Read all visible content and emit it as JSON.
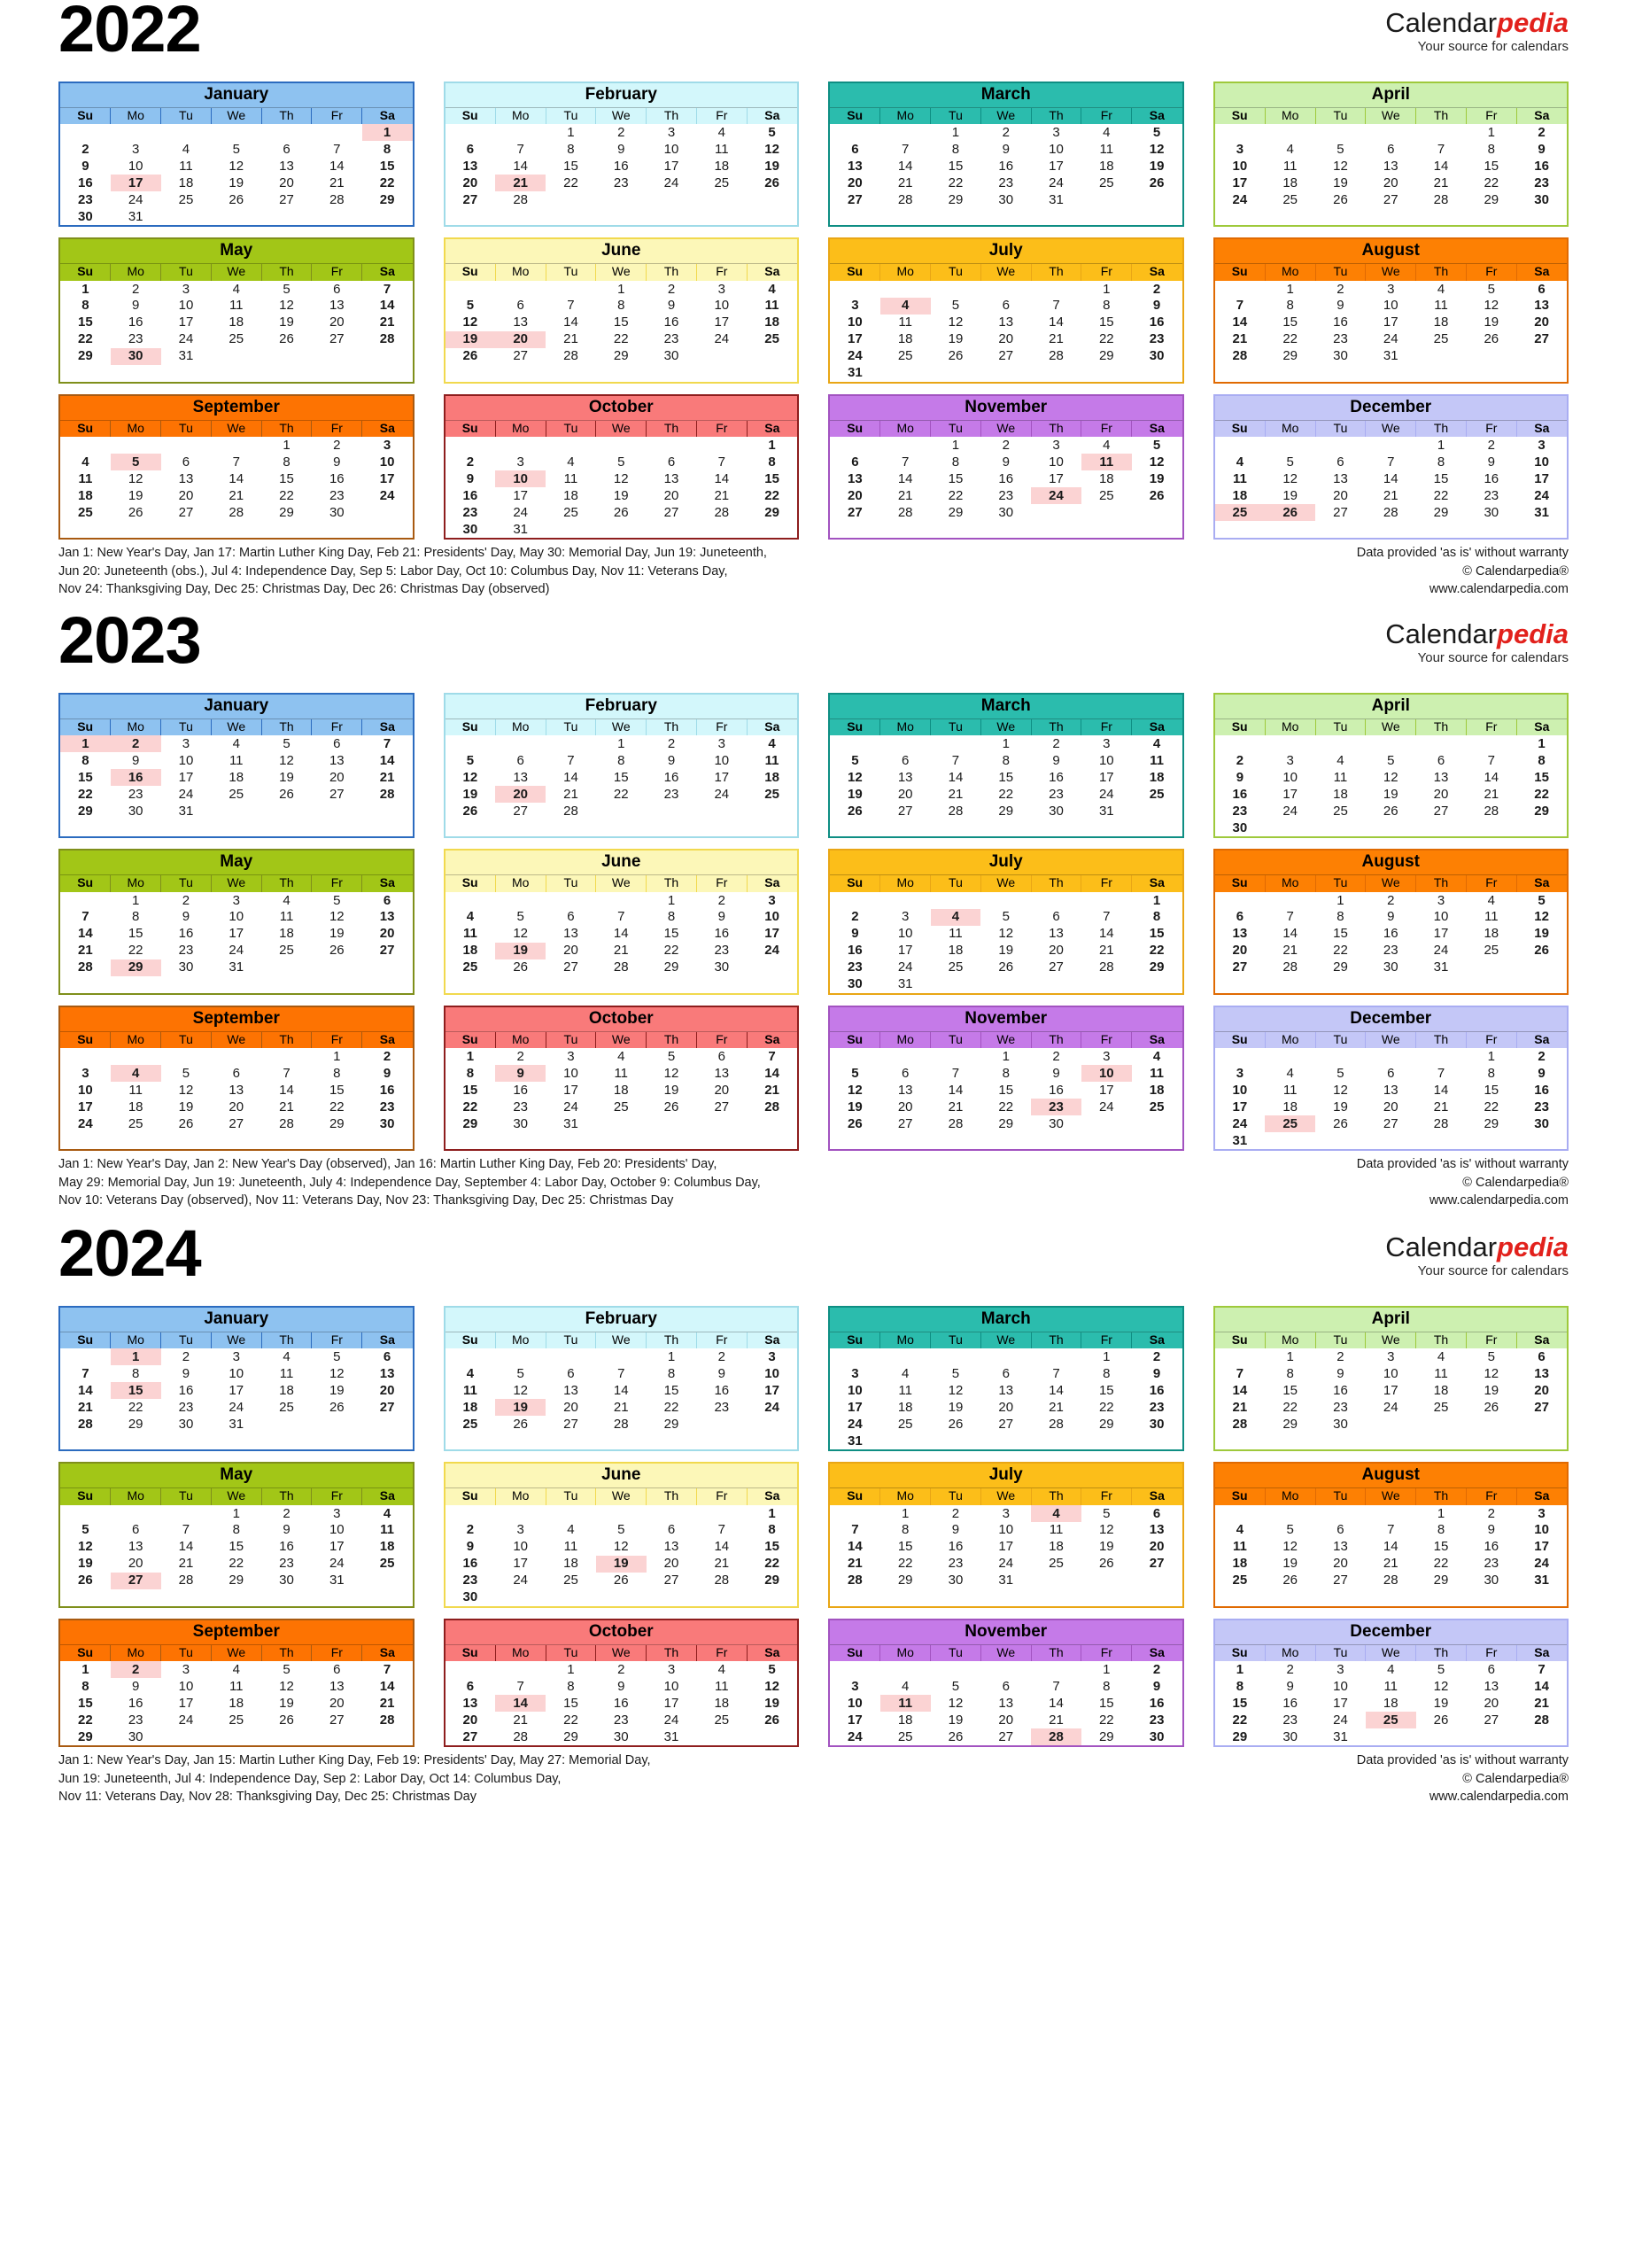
{
  "brand": {
    "name_part1": "Calendar",
    "name_part2": "pedia",
    "tagline": "Your source for calendars"
  },
  "disclaimer": {
    "line1": "Data provided 'as is' without warranty",
    "line2": "© Calendarpedia®",
    "line3": "www.calendarpedia.com"
  },
  "weekdays": [
    "Su",
    "Mo",
    "Tu",
    "We",
    "Th",
    "Fr",
    "Sa"
  ],
  "colors": {
    "january": "#8ec2f0",
    "february": "#d3f7fb",
    "march": "#2bbcad",
    "april": "#cdf0b0",
    "may": "#a2c617",
    "june": "#fcf7b8",
    "july": "#fcbe19",
    "august": "#fd8003",
    "september": "#fd7302",
    "october": "#f97a7a",
    "november": "#c57ae8",
    "december": "#c4c7f7",
    "january_border": "#2b6bbf",
    "february_border": "#9fdbe8",
    "march_border": "#0e8e83",
    "april_border": "#9ec93b",
    "may_border": "#7f8f1b",
    "june_border": "#f1d94e",
    "july_border": "#e9a615",
    "august_border": "#e06a02",
    "september_border": "#a85a11",
    "october_border": "#8e1e1e",
    "november_border": "#a253c0",
    "december_border": "#a9adf2",
    "sunday_text": "#e00000",
    "saturday_text": "#0000d8",
    "holiday_bg": "#fbd3d3",
    "brand_red": "#e2211c"
  },
  "years": [
    {
      "year": "2022",
      "holidays_text": [
        "Jan 1: New Year's Day, Jan 17: Martin Luther King Day, Feb 21: Presidents' Day, May 30: Memorial Day, Jun 19: Juneteenth,",
        "Jun 20: Juneteenth (obs.), Jul 4: Independence Day, Sep 5: Labor Day, Oct 10: Columbus Day, Nov 11: Veterans Day,",
        "Nov 24: Thanksgiving Day, Dec 25: Christmas Day, Dec 26: Christmas Day (observed)"
      ],
      "months": [
        {
          "name": "January",
          "key": "january",
          "first_weekday": 6,
          "days": 31,
          "holidays": [
            1,
            17
          ]
        },
        {
          "name": "February",
          "key": "february",
          "first_weekday": 2,
          "days": 28,
          "holidays": [
            21
          ]
        },
        {
          "name": "March",
          "key": "march",
          "first_weekday": 2,
          "days": 31,
          "holidays": []
        },
        {
          "name": "April",
          "key": "april",
          "first_weekday": 5,
          "days": 30,
          "holidays": []
        },
        {
          "name": "May",
          "key": "may",
          "first_weekday": 0,
          "days": 31,
          "holidays": [
            30
          ]
        },
        {
          "name": "June",
          "key": "june",
          "first_weekday": 3,
          "days": 30,
          "holidays": [
            19,
            20
          ]
        },
        {
          "name": "July",
          "key": "july",
          "first_weekday": 5,
          "days": 31,
          "holidays": [
            4
          ]
        },
        {
          "name": "August",
          "key": "august",
          "first_weekday": 1,
          "days": 31,
          "holidays": []
        },
        {
          "name": "September",
          "key": "september",
          "first_weekday": 4,
          "days": 30,
          "holidays": [
            5
          ]
        },
        {
          "name": "October",
          "key": "october",
          "first_weekday": 6,
          "days": 31,
          "holidays": [
            10
          ]
        },
        {
          "name": "November",
          "key": "november",
          "first_weekday": 2,
          "days": 30,
          "holidays": [
            11,
            24
          ]
        },
        {
          "name": "December",
          "key": "december",
          "first_weekday": 4,
          "days": 31,
          "holidays": [
            25,
            26
          ]
        }
      ]
    },
    {
      "year": "2023",
      "holidays_text": [
        "Jan 1: New Year's Day, Jan 2: New Year's Day (observed), Jan 16: Martin Luther King Day, Feb 20: Presidents' Day,",
        "May 29: Memorial Day, Jun 19: Juneteenth, July 4: Independence Day, September 4: Labor Day, October 9: Columbus Day,",
        "Nov 10: Veterans Day (observed), Nov 11: Veterans Day, Nov 23: Thanksgiving Day, Dec 25: Christmas Day"
      ],
      "months": [
        {
          "name": "January",
          "key": "january",
          "first_weekday": 0,
          "days": 31,
          "holidays": [
            1,
            2,
            16
          ]
        },
        {
          "name": "February",
          "key": "february",
          "first_weekday": 3,
          "days": 28,
          "holidays": [
            20
          ]
        },
        {
          "name": "March",
          "key": "march",
          "first_weekday": 3,
          "days": 31,
          "holidays": []
        },
        {
          "name": "April",
          "key": "april",
          "first_weekday": 6,
          "days": 30,
          "holidays": []
        },
        {
          "name": "May",
          "key": "may",
          "first_weekday": 1,
          "days": 31,
          "holidays": [
            29
          ]
        },
        {
          "name": "June",
          "key": "june",
          "first_weekday": 4,
          "days": 30,
          "holidays": [
            19
          ]
        },
        {
          "name": "July",
          "key": "july",
          "first_weekday": 6,
          "days": 31,
          "holidays": [
            4
          ]
        },
        {
          "name": "August",
          "key": "august",
          "first_weekday": 2,
          "days": 31,
          "holidays": []
        },
        {
          "name": "September",
          "key": "september",
          "first_weekday": 5,
          "days": 30,
          "holidays": [
            4
          ]
        },
        {
          "name": "October",
          "key": "october",
          "first_weekday": 0,
          "days": 31,
          "holidays": [
            9
          ]
        },
        {
          "name": "November",
          "key": "november",
          "first_weekday": 3,
          "days": 30,
          "holidays": [
            10,
            23
          ]
        },
        {
          "name": "December",
          "key": "december",
          "first_weekday": 5,
          "days": 31,
          "holidays": [
            25
          ]
        }
      ]
    },
    {
      "year": "2024",
      "holidays_text": [
        "Jan 1: New Year's Day, Jan 15: Martin Luther King Day, Feb 19: Presidents' Day, May 27: Memorial Day,",
        "Jun 19: Juneteenth, Jul 4: Independence Day, Sep 2: Labor Day, Oct 14: Columbus Day,",
        "Nov 11: Veterans Day, Nov 28: Thanksgiving Day, Dec 25: Christmas Day"
      ],
      "months": [
        {
          "name": "January",
          "key": "january",
          "first_weekday": 1,
          "days": 31,
          "holidays": [
            1,
            15
          ]
        },
        {
          "name": "February",
          "key": "february",
          "first_weekday": 4,
          "days": 29,
          "holidays": [
            19
          ]
        },
        {
          "name": "March",
          "key": "march",
          "first_weekday": 5,
          "days": 31,
          "holidays": []
        },
        {
          "name": "April",
          "key": "april",
          "first_weekday": 1,
          "days": 30,
          "holidays": []
        },
        {
          "name": "May",
          "key": "may",
          "first_weekday": 3,
          "days": 31,
          "holidays": [
            27
          ]
        },
        {
          "name": "June",
          "key": "june",
          "first_weekday": 6,
          "days": 30,
          "holidays": [
            19
          ]
        },
        {
          "name": "July",
          "key": "july",
          "first_weekday": 1,
          "days": 31,
          "holidays": [
            4
          ]
        },
        {
          "name": "August",
          "key": "august",
          "first_weekday": 4,
          "days": 31,
          "holidays": []
        },
        {
          "name": "September",
          "key": "september",
          "first_weekday": 0,
          "days": 30,
          "holidays": [
            2
          ]
        },
        {
          "name": "October",
          "key": "october",
          "first_weekday": 2,
          "days": 31,
          "holidays": [
            14
          ]
        },
        {
          "name": "November",
          "key": "november",
          "first_weekday": 5,
          "days": 30,
          "holidays": [
            11,
            28
          ]
        },
        {
          "name": "December",
          "key": "december",
          "first_weekday": 0,
          "days": 31,
          "holidays": [
            25
          ]
        }
      ]
    }
  ]
}
